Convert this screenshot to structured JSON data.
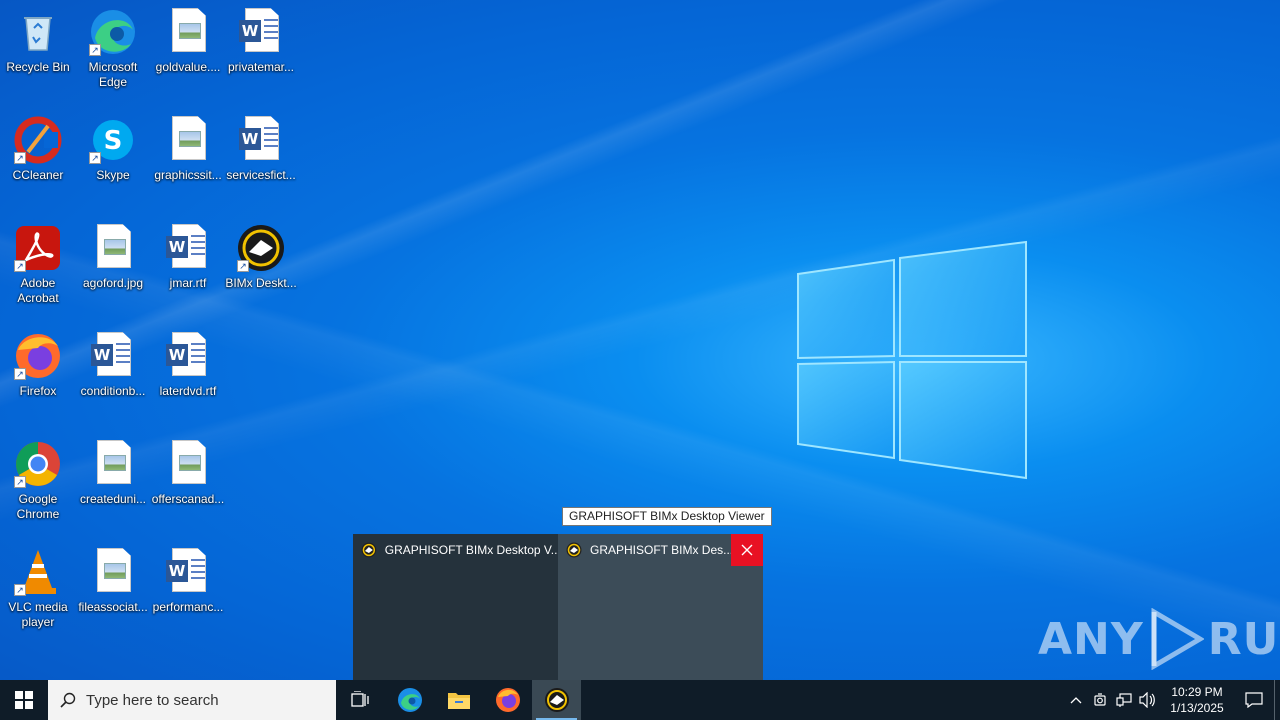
{
  "desktop": {
    "icons": [
      {
        "label": "Recycle Bin",
        "icon": "recycle-bin-icon"
      },
      {
        "label": "Microsoft Edge",
        "icon": "edge-icon"
      },
      {
        "label": "goldvalue....",
        "icon": "image-file-icon"
      },
      {
        "label": "privatemar...",
        "icon": "word-doc-icon"
      },
      {
        "label": "CCleaner",
        "icon": "ccleaner-icon"
      },
      {
        "label": "Skype",
        "icon": "skype-icon"
      },
      {
        "label": "graphicssit...",
        "icon": "image-file-icon"
      },
      {
        "label": "servicesfict...",
        "icon": "word-doc-icon"
      },
      {
        "label": "Adobe Acrobat",
        "icon": "acrobat-icon"
      },
      {
        "label": "agoford.jpg",
        "icon": "image-file-icon"
      },
      {
        "label": "jmar.rtf",
        "icon": "word-doc-icon"
      },
      {
        "label": "BIMx Deskt...",
        "icon": "bimx-icon"
      },
      {
        "label": "Firefox",
        "icon": "firefox-icon"
      },
      {
        "label": "conditionb...",
        "icon": "word-doc-icon"
      },
      {
        "label": "laterdvd.rtf",
        "icon": "word-doc-icon"
      },
      {
        "label": "Google Chrome",
        "icon": "chrome-icon"
      },
      {
        "label": "createduni...",
        "icon": "image-file-icon"
      },
      {
        "label": "offerscanad...",
        "icon": "image-file-icon"
      },
      {
        "label": "VLC media player",
        "icon": "vlc-icon"
      },
      {
        "label": "fileassociat...",
        "icon": "image-file-icon"
      },
      {
        "label": "performanc...",
        "icon": "word-doc-icon"
      }
    ]
  },
  "tooltip": {
    "text": "GRAPHISOFT BIMx Desktop Viewer"
  },
  "thumbnails": [
    {
      "title": "GRAPHISOFT BIMx Desktop V..."
    },
    {
      "title": "GRAPHISOFT BIMx Des..."
    }
  ],
  "watermark": {
    "left": "ANY",
    "right": "RUN"
  },
  "taskbar": {
    "search_placeholder": "Type here to search",
    "pinned": [
      "task-view-icon",
      "edge-icon",
      "file-explorer-icon",
      "firefox-icon",
      "bimx-icon"
    ],
    "clock_time": "10:29 PM",
    "clock_date": "1/13/2025"
  },
  "colors": {
    "accent": "#76b9ed",
    "close": "#e81123",
    "taskbar": "#0f1c28"
  }
}
